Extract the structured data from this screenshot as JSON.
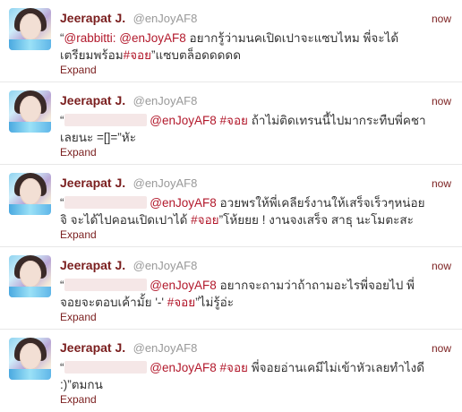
{
  "tweets": [
    {
      "fullname": "Jeerapat J.",
      "username": "@enJoyAF8",
      "time": "now",
      "prefix": "“",
      "mention1": "@rabbitti:",
      "mention2": "@enJoyAF8",
      "text_main": "อยากรู้ว่ามนคเปิดเปาจะแซบไหม พี่จะได้เตรียมพร้อม",
      "hashtag": "#จอย",
      "text_end": "”แซบตล็อดดดดด",
      "expand": "Expand"
    },
    {
      "fullname": "Jeerapat J.",
      "username": "@enJoyAF8",
      "time": "now",
      "prefix": "“",
      "mention": "@enJoyAF8",
      "hashtag": "#จอย",
      "text_main": "ถ้าไม่ติดเทรนนี้ไปมากระทืบพี่คชาเลยนะ =[]=”หัะ",
      "expand": "Expand"
    },
    {
      "fullname": "Jeerapat J.",
      "username": "@enJoyAF8",
      "time": "now",
      "prefix": "“",
      "mention": "@enJoyAF8",
      "text_main": "อวยพรให้พี่เคลียร์งานให้เสร็จเร็วๆหน่อยจิ จะได้ไปคอนเปิดเปาได้",
      "hashtag": "#จอย",
      "text_end": "”โห้ยยย ! งานจงเสร็จ สาธุ นะโมตะสะ",
      "expand": "Expand"
    },
    {
      "fullname": "Jeerapat J.",
      "username": "@enJoyAF8",
      "time": "now",
      "prefix": "“",
      "mention": "@enJoyAF8",
      "text_main": "อยากจะถามว่าถ้าถามอะไรพี่จอยไป พี่จอยจะตอบเค้ามั้ย '-'",
      "hashtag": "#จอย",
      "text_end": "”ไม่รู้อ่ะ",
      "expand": "Expand"
    },
    {
      "fullname": "Jeerapat J.",
      "username": "@enJoyAF8",
      "time": "now",
      "prefix": "“",
      "mention": "@enJoyAF8",
      "hashtag": "#จอย",
      "text_main": "พี่จอยอ่านเคมีไม่เข้าหัวเลยทำไงดี :)”ตมกน",
      "expand": "Expand"
    }
  ],
  "colors": {
    "name": "#7a1e1e",
    "link": "#b2182b",
    "muted": "#999999",
    "text": "#333333",
    "redaction": "#f5e7e7"
  },
  "icons": {
    "avatar": "avatar-photo"
  }
}
